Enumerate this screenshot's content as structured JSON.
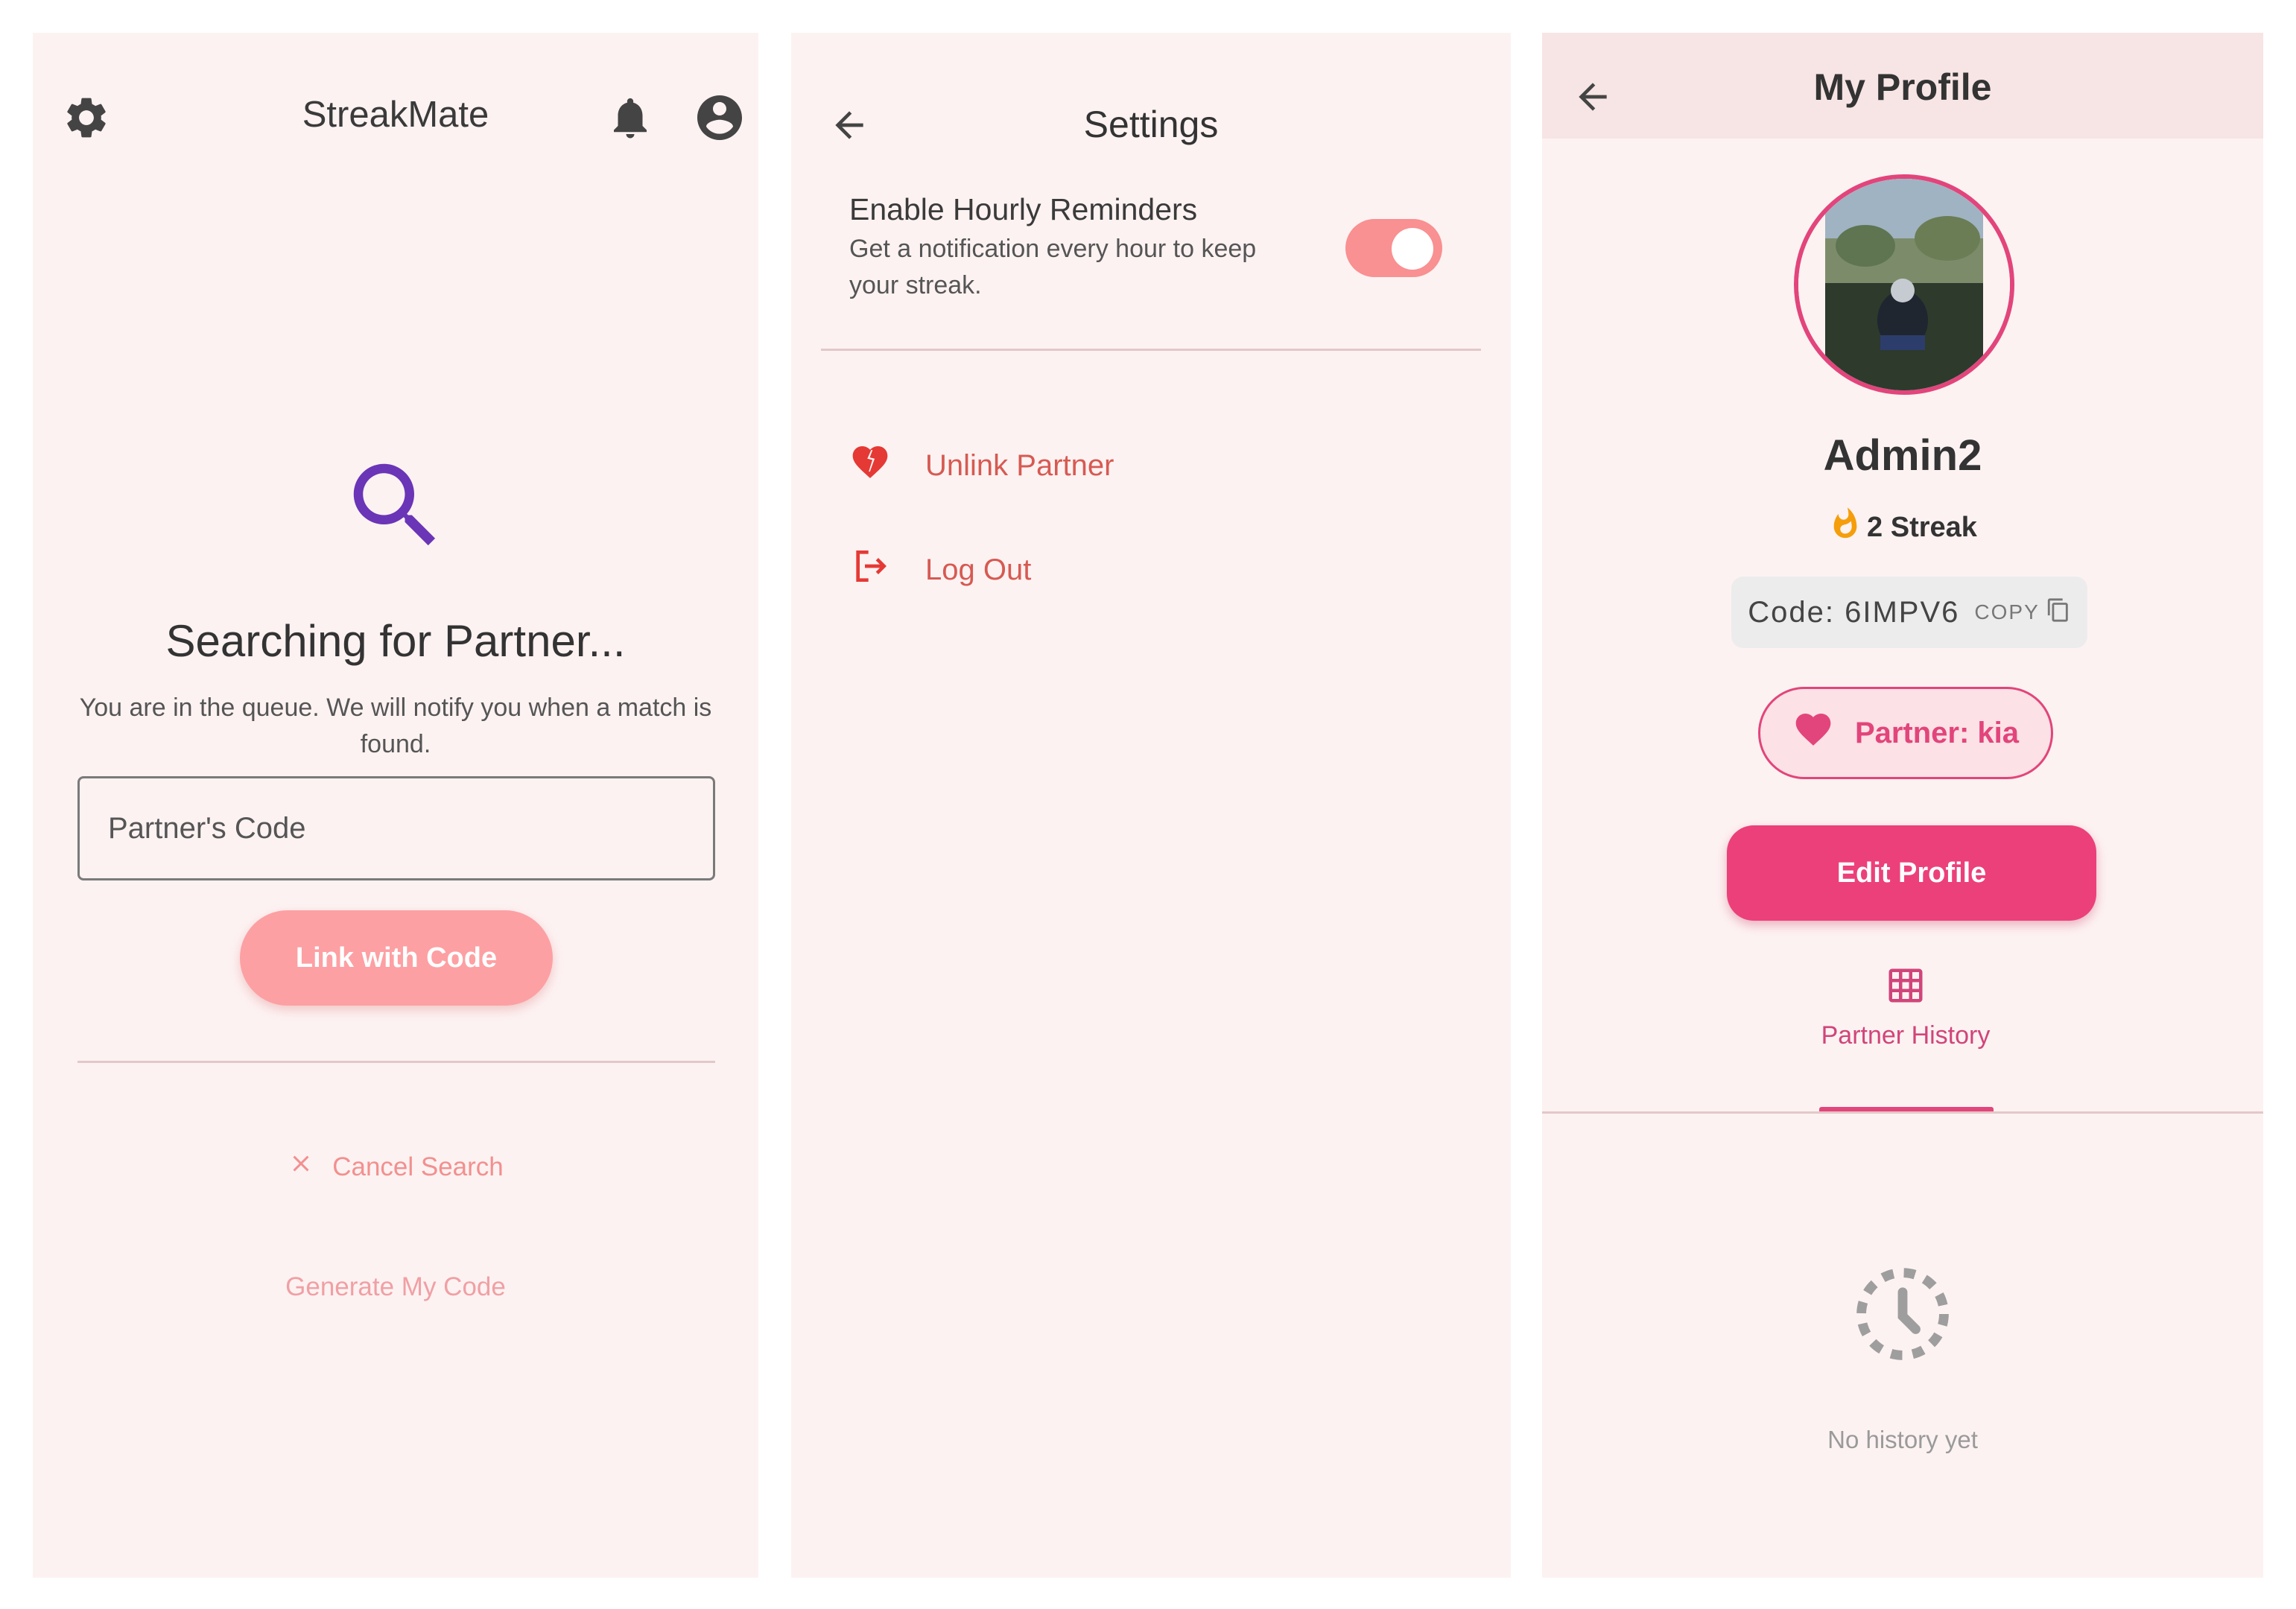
{
  "colors": {
    "screen_bg": "#fdf2f2",
    "primary_pink": "#ec407a",
    "accent_coral": "#f99091",
    "search_purple": "#6a35b6",
    "danger_red": "#d65a52"
  },
  "screen1": {
    "app_title": "StreakMate",
    "icons": {
      "settings": "gear-icon",
      "notifications": "bell-icon",
      "account": "account-circle-icon",
      "search": "search-icon"
    },
    "heading": "Searching for Partner...",
    "subtitle": "You are in the queue. We will notify you when a match is found.",
    "code_input": {
      "placeholder": "Partner's Code",
      "value": ""
    },
    "link_button": "Link with Code",
    "cancel_search": "Cancel Search",
    "generate_code": "Generate My Code"
  },
  "screen2": {
    "title": "Settings",
    "hourly_reminders": {
      "label": "Enable Hourly Reminders",
      "description": "Get a notification every hour to keep your streak.",
      "enabled": true
    },
    "menu": [
      {
        "label": "Unlink Partner",
        "icon": "broken-heart-icon"
      },
      {
        "label": "Log Out",
        "icon": "logout-icon"
      }
    ]
  },
  "screen3": {
    "title": "My Profile",
    "username": "Admin2",
    "streak_text": "2 Streak",
    "code_text": "Code: 6IMPV6",
    "copy_label": "COPY",
    "partner_text": "Partner: kia",
    "edit_button": "Edit Profile",
    "tab_label": "Partner History",
    "empty_text": "No history yet"
  }
}
